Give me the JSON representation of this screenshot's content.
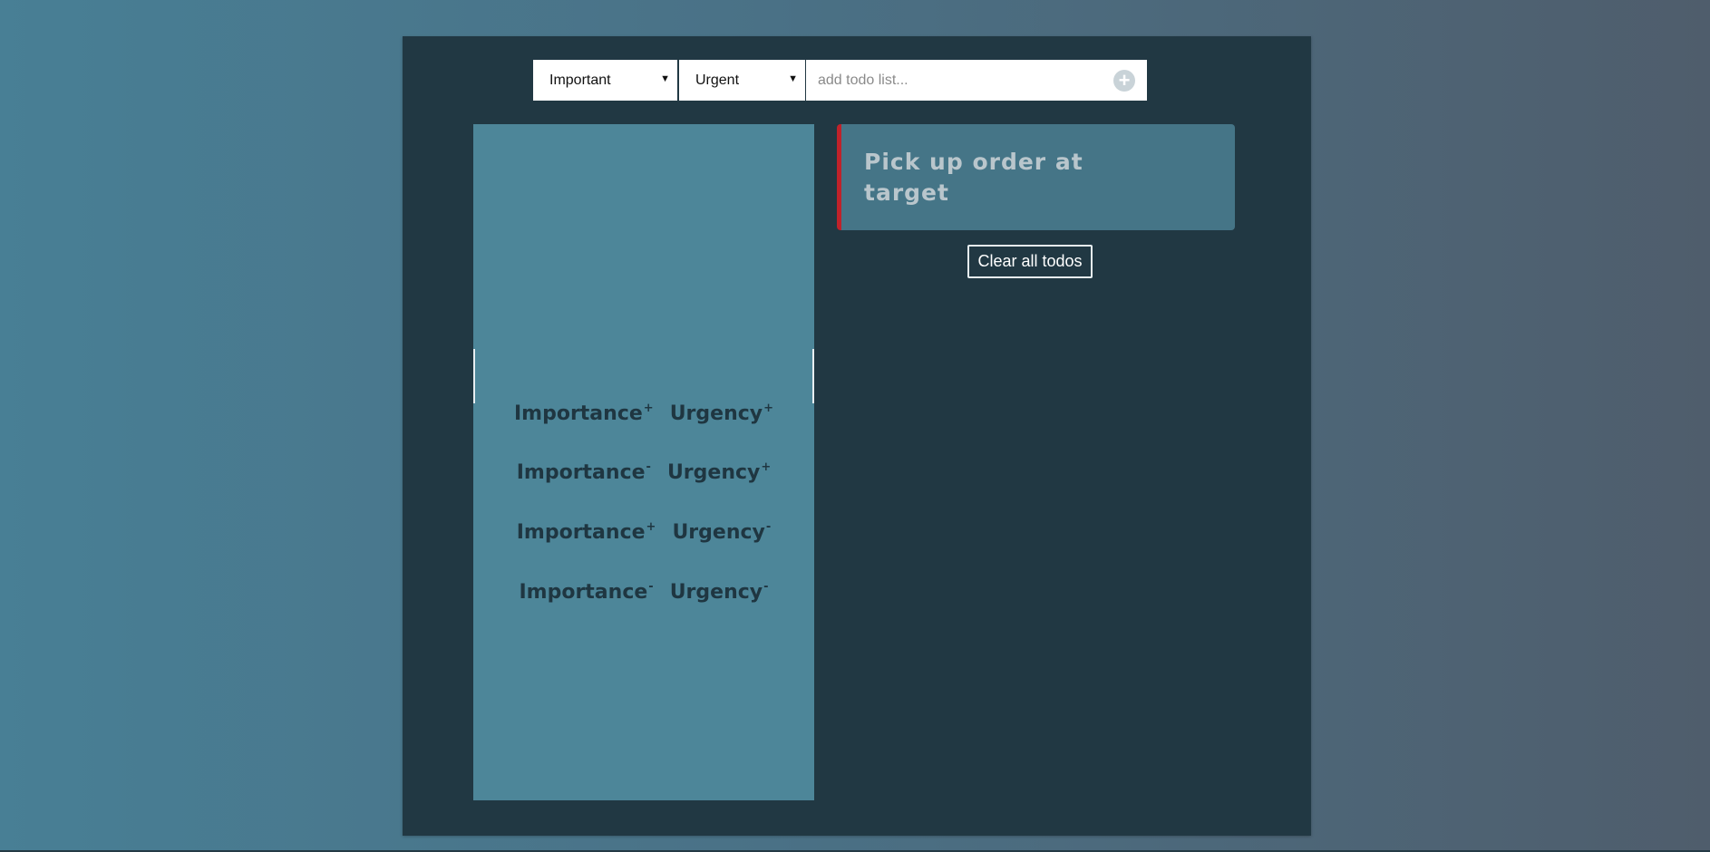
{
  "toolbar": {
    "importance_select": {
      "selected": "Important"
    },
    "urgency_select": {
      "selected": "Urgent"
    },
    "todo_input": {
      "placeholder": "add todo list...",
      "value": ""
    },
    "add_button_glyph": "+"
  },
  "priority_panel": {
    "rows": [
      {
        "importance": "Importance",
        "importance_sign": "+",
        "urgency": "Urgency",
        "urgency_sign": "+"
      },
      {
        "importance": "Importance",
        "importance_sign": "-",
        "urgency": "Urgency",
        "urgency_sign": "+"
      },
      {
        "importance": "Importance",
        "importance_sign": "+",
        "urgency": "Urgency",
        "urgency_sign": "-"
      },
      {
        "importance": "Importance",
        "importance_sign": "-",
        "urgency": "Urgency",
        "urgency_sign": "-"
      }
    ]
  },
  "todos": [
    {
      "text": "Pick up order at target",
      "priority_color": "#c0222a"
    }
  ],
  "clear_button_label": "Clear all todos",
  "icons": {
    "select_caret": "caret-down-icon",
    "add": "plus-circle-icon"
  },
  "colors": {
    "frame": "#213843",
    "panel": "#4d8699",
    "card": "#457587",
    "accent_red": "#c0222a"
  }
}
